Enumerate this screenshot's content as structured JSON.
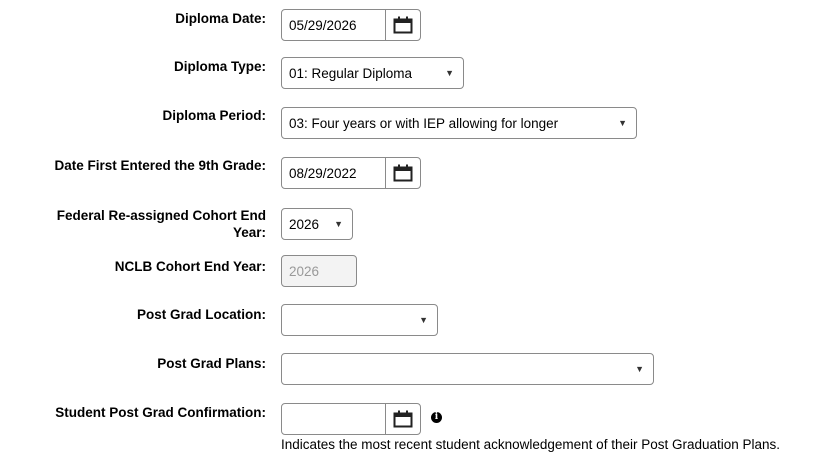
{
  "fields": {
    "diploma_date": {
      "label": "Diploma Date:",
      "value": "05/29/2026"
    },
    "diploma_type": {
      "label": "Diploma Type:",
      "value": "01: Regular Diploma"
    },
    "diploma_period": {
      "label": "Diploma Period:",
      "value": "03: Four years or with IEP allowing for longer"
    },
    "date_first_9th": {
      "label": "Date First Entered the 9th Grade:",
      "value": "08/29/2022"
    },
    "federal_cohort": {
      "label_line1": "Federal Re-assigned Cohort End",
      "label_line2": "Year:",
      "value": "2026"
    },
    "nclb_cohort": {
      "label": "NCLB Cohort End Year:",
      "value": "2026"
    },
    "post_grad_location": {
      "label": "Post Grad Location:",
      "value": ""
    },
    "post_grad_plans": {
      "label": "Post Grad Plans:",
      "value": ""
    },
    "student_confirmation": {
      "label": "Student Post Grad Confirmation:",
      "value": "",
      "help_text": "Indicates the most recent student acknowledgement of their Post Graduation Plans."
    }
  },
  "icons": {
    "calendar": "calendar-icon",
    "dropdown": "triangle-down",
    "info": "info-icon"
  }
}
